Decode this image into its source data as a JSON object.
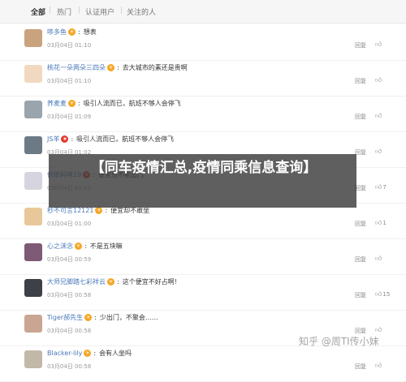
{
  "tabs": [
    "全部",
    "热门",
    "认证用户",
    "关注的人"
  ],
  "actions": {
    "reply": "回复",
    "like_icon": "thumbs-up-icon"
  },
  "comments": [
    {
      "user": "哆多鱼",
      "badge": "sun",
      "text": "想表",
      "time": "03月04日 01:10",
      "likes": ""
    },
    {
      "user": "桃花一朵两朵三四朵",
      "badge": "sun",
      "text": "去大城市的素还是贵啊",
      "time": "03月04日 01:10",
      "likes": ""
    },
    {
      "user": "荞麦麦",
      "badge": "sun",
      "text": "吸引人流而已，航班不够人会停飞",
      "time": "03月04日 01:09",
      "likes": ""
    },
    {
      "user": "JS羊",
      "badge": "star",
      "text": "吸引人流而已，航班不够人会停飞",
      "time": "03月04日 01:02",
      "likes": ""
    },
    {
      "user": "依依妈咪19",
      "badge": "v",
      "text": "便宜也不能出门",
      "time": "03月04日 01:01",
      "likes": "7"
    },
    {
      "user": "秒不可言12121",
      "badge": "sun",
      "text": "便宜却不敢坐",
      "time": "03月04日 01:00",
      "likes": "1"
    },
    {
      "user": "心之沫念",
      "badge": "sun",
      "text": "不是五块嘛",
      "time": "03月04日 00:59",
      "likes": ""
    },
    {
      "user": "大师兄脚踏七彩祥云",
      "badge": "sun",
      "text": "这个便宜不好占啊!",
      "time": "03月04日 00:58",
      "likes": "15"
    },
    {
      "user": "Tiger郝先生",
      "badge": "sun",
      "text": "少出门，不聚会……",
      "time": "03月04日 00:58",
      "likes": ""
    },
    {
      "user": "Blacker-lily",
      "badge": "sun",
      "text": "会有人坐吗",
      "time": "03月04日 00:58",
      "likes": ""
    }
  ],
  "banner": "【同车疫情汇总,疫情同乘信息查询】",
  "watermark": "知乎 @周TI传小妹",
  "colors": {
    "username": "#4a79b8",
    "badge_sun": "#f5a623",
    "badge_star": "#e23b2e",
    "badge_v": "#e8462b"
  }
}
